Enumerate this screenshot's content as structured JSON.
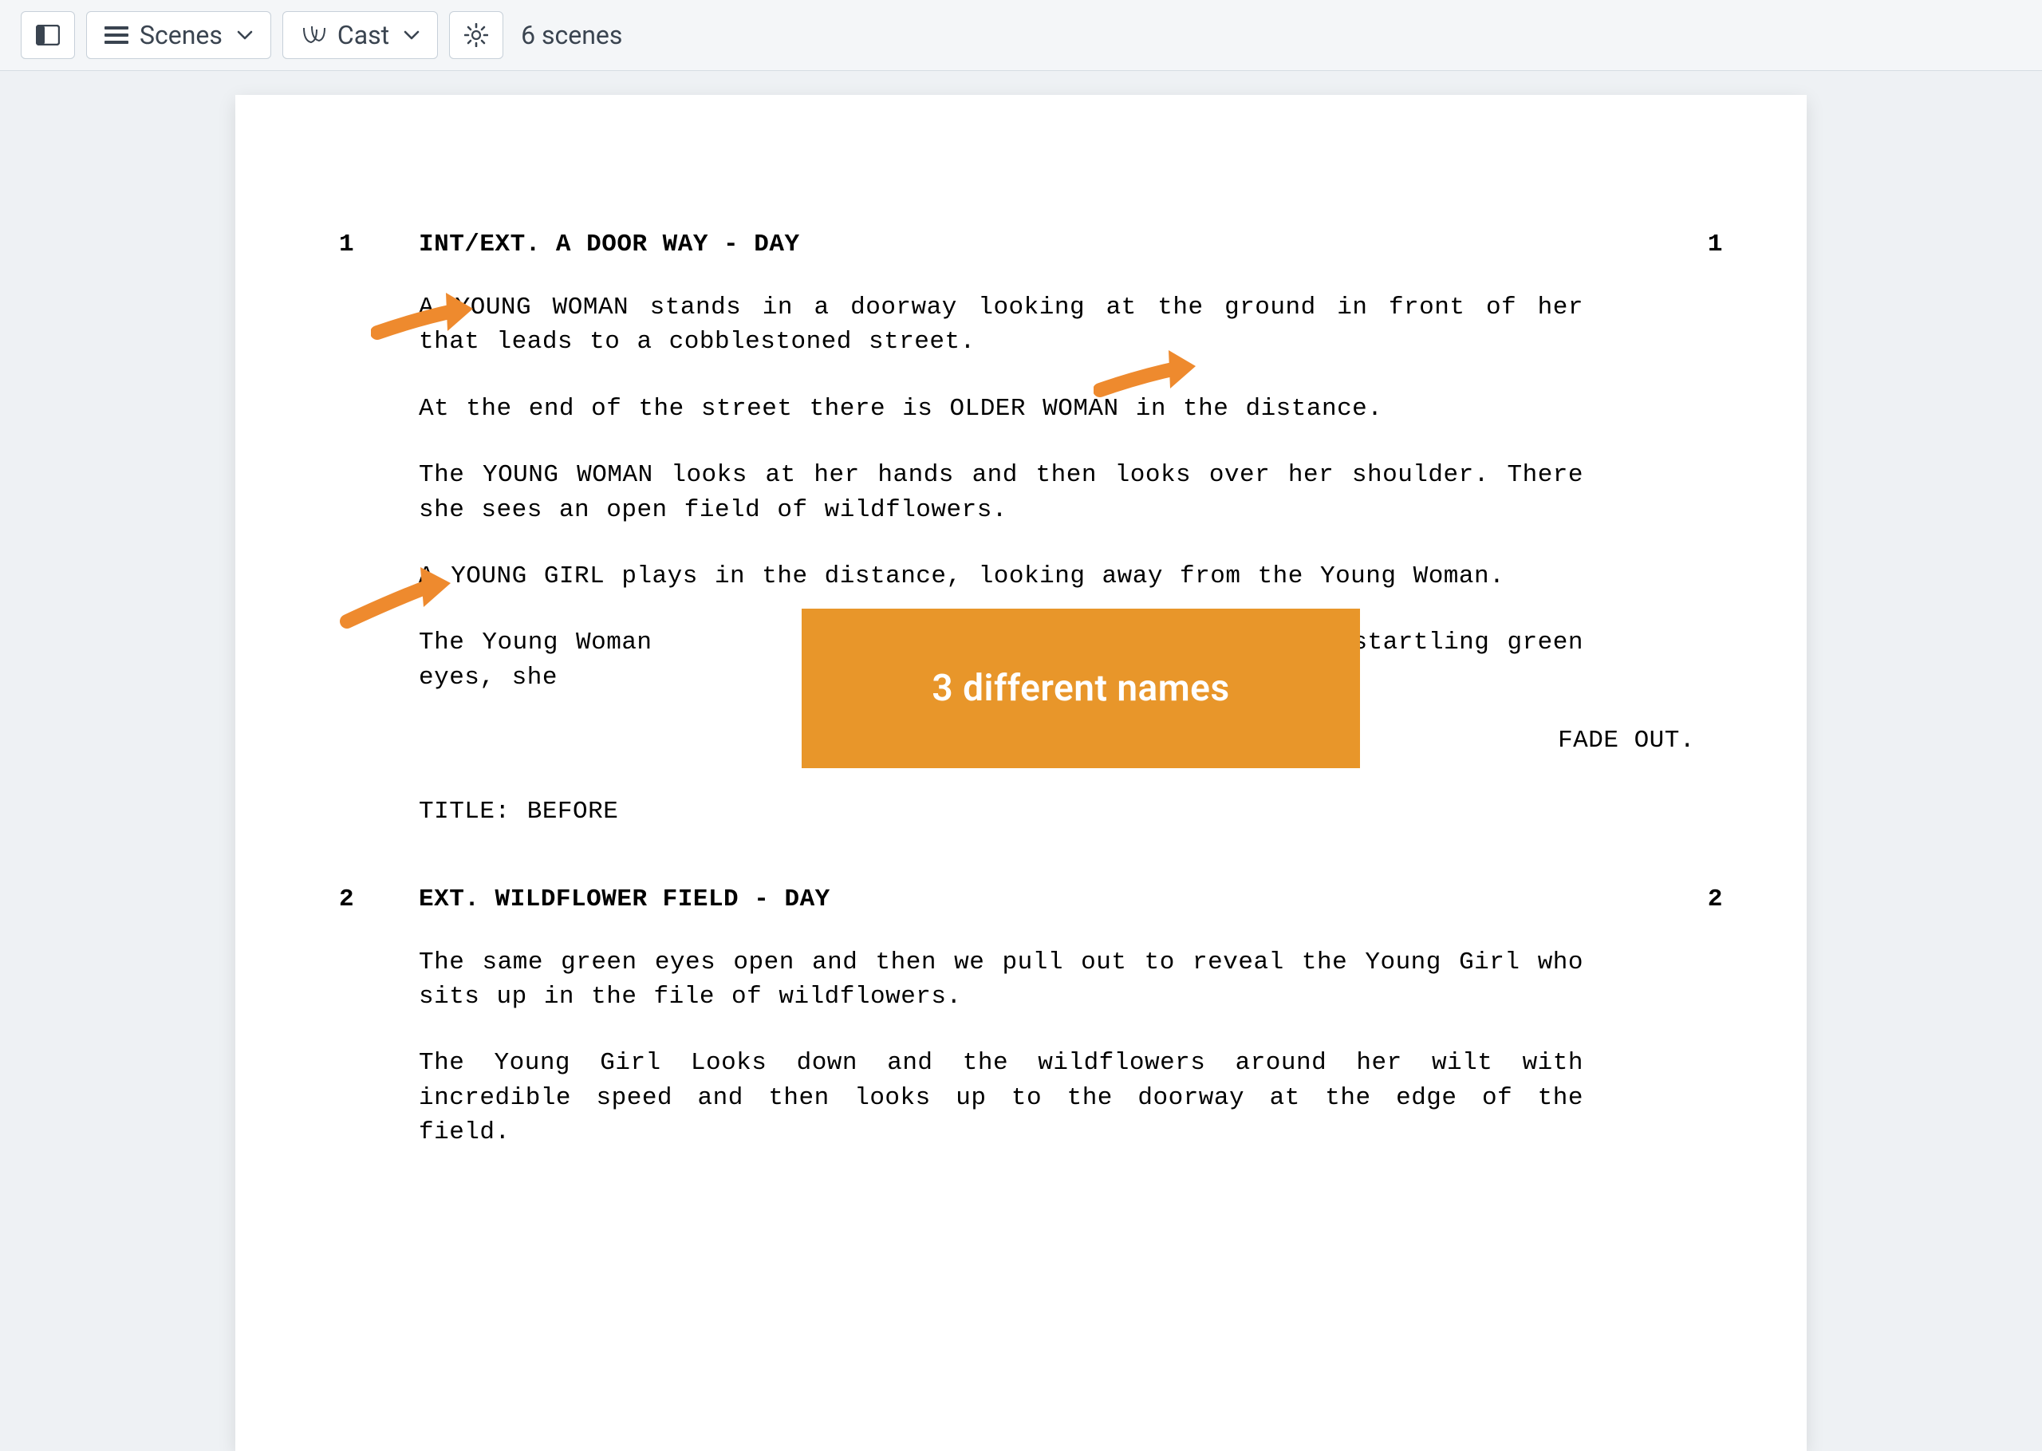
{
  "toolbar": {
    "scenes_label": "Scenes",
    "cast_label": "Cast",
    "status_text": "6 scenes"
  },
  "annotation": {
    "callout_text": "3 different names",
    "callout_color": "#e8962a"
  },
  "script": {
    "scenes": [
      {
        "number_left": "1",
        "number_right": "1",
        "heading": "INT/EXT. A DOOR WAY - DAY",
        "actions": [
          "A YOUNG WOMAN stands in a doorway looking at the ground in front of her that leads to a cobblestoned street.",
          "At the end of the street there is     OLDER WOMAN in the distance.",
          "The YOUNG WOMAN looks at her hands and then looks over her shoulder. There she sees an open field of wildflowers.",
          "A YOUNG GIRL plays in the distance, looking away from the Young Woman.",
          "The Young Woman                                     on startling green eyes, she"
        ],
        "transition": "FADE OUT.",
        "title_card": "TITLE: BEFORE"
      },
      {
        "number_left": "2",
        "number_right": "2",
        "heading": "EXT. WILDFLOWER FIELD - DAY",
        "actions": [
          "The same green eyes open and then we pull out to reveal the Young Girl who sits up in the file of wildflowers.",
          "The Young Girl Looks down and the wildflowers around her wilt with incredible speed and then looks up to the doorway at the edge of the field."
        ]
      }
    ]
  }
}
